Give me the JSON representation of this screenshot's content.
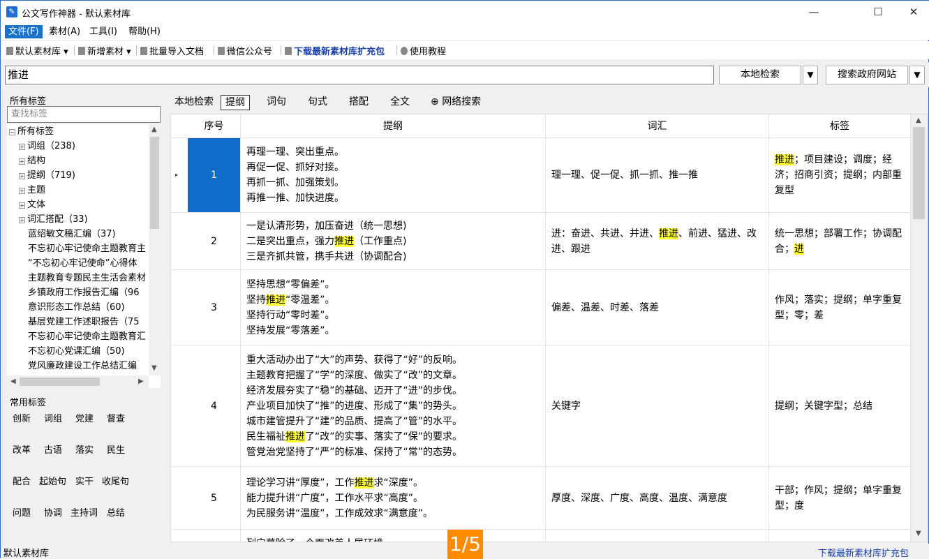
{
  "window": {
    "title": "公文写作神器 - 默认素材库",
    "app_icon": "pen-icon"
  },
  "menu": [
    "文件(F)",
    "素材(A)",
    "工具(I)",
    "帮助(H)"
  ],
  "toolbar": {
    "library": "默认素材库",
    "new_material": "新增素材",
    "batch_import": "批量导入文档",
    "wechat": "微信公众号",
    "download": "下载最新素材库扩充包",
    "tutorial": "使用教程"
  },
  "search": {
    "query": "推进",
    "local_btn": "本地检索",
    "gov_btn": "搜索政府网站"
  },
  "left": {
    "all_tags_header": "所有标签",
    "tag_search_placeholder": "查找标签",
    "tree": [
      "所有标签",
      "词组（238)",
      "结构",
      "提纲（719)",
      "主题",
      "文体",
      "词汇搭配（33)",
      "蓝绍敏文稿汇编（37)",
      "不忘初心牢记使命主题教育主",
      "“不忘初心牢记使命”心得体",
      "主题教育专题民主生活会素材",
      "乡镇政府工作报告汇编（96",
      "意识形态工作总结（60)",
      "基层党建工作述职报告（75",
      "不忘初心牢记使命主题教育汇",
      "不忘初心党课汇编（50)",
      "党风廉政建设工作总结汇编"
    ],
    "common_header": "常用标签",
    "common_tags": [
      "创新",
      "词组",
      "党建",
      "督查",
      "改革",
      "古语",
      "落实",
      "民生",
      "配合",
      "起始句",
      "实干",
      "收尾句",
      "问题",
      "协调",
      "主持词",
      "总结"
    ]
  },
  "tabs": [
    "本地检索",
    "提纲",
    "词句",
    "句式",
    "搭配",
    "全文",
    "网络搜索"
  ],
  "grid": {
    "headers": [
      "序号",
      "提纲",
      "词汇",
      "标签"
    ],
    "rows": [
      {
        "num": "1",
        "outline": [
          "再理一理、突出重点。",
          "再促一促、抓好对接。",
          "再抓一抓、加强策划。",
          "再推一推、加快进度。"
        ],
        "vocab": "理一理、促一促、抓一抓、推一推",
        "tags": "推进；项目建设；调度；经济；招商引资；提纲；内部重复型"
      },
      {
        "num": "2",
        "outline": [
          "一是认清形势，加压奋进（统一思想)",
          "二是突出重点，强力推进（工作重点)",
          "三是齐抓共管，携手共进（协调配合)"
        ],
        "vocab": "进：奋进、共进、并进、推进、前进、猛进、改进、跟进",
        "tags": "统一思想；部署工作；协调配合；进"
      },
      {
        "num": "3",
        "outline": [
          "坚持思想“零偏差”。",
          "坚持推进“零温差”。",
          "坚持行动“零时差”。",
          "坚持发展“零落差”。"
        ],
        "vocab": "偏差、温差、时差、落差",
        "tags": "作风；落实；提纲；单字重复型；零；差"
      },
      {
        "num": "4",
        "outline": [
          "重大活动办出了“大”的声势、获得了“好”的反响。",
          "主题教育把握了“学”的深度、做实了“改”的文章。",
          "经济发展夯实了“稳”的基础、迈开了“进”的步伐。",
          "产业项目加快了“推”的进度、形成了“集”的势头。",
          "城市建管提升了“建”的品质、提高了“管”的水平。",
          " 民生福祉推进了“改”的实事、落实了“保”的要求。",
          "管党治党坚持了“严”的标准、保持了“常”的态势。"
        ],
        "vocab": "关键字",
        "tags": "提纲；关键字型；总结"
      },
      {
        "num": "5",
        "outline": [
          "理论学习讲“厚度”，工作推进求“深度”。",
          "能力提升讲“广度”，工作水平求“高度”。",
          "为民服务讲“温度”，工作成效求“满意度”。"
        ],
        "vocab": "厚度、深度、广度、高度、温度、满意度",
        "tags": "干部；作风；提纲；单字重复型；度"
      },
      {
        "num": "",
        "outline": [
          "列宁墓除了一个面改美人居环境"
        ],
        "vocab": "",
        "tags": ""
      }
    ]
  },
  "status": {
    "left": "默认素材库",
    "right": "下载最新素材库扩充包",
    "pager": "1/5"
  },
  "highlight": "推进"
}
